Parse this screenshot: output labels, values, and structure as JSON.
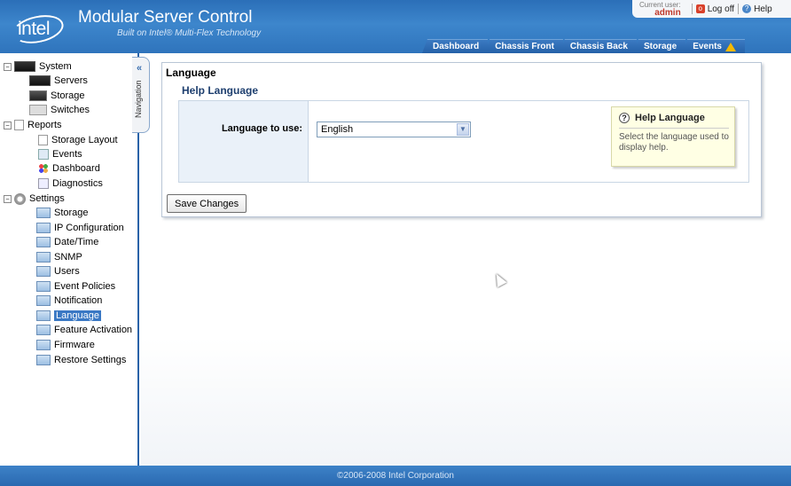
{
  "header": {
    "logo": "intel",
    "title": "Modular Server Control",
    "subtitle": "Built on Intel® Multi-Flex Technology",
    "current_user_label": "Current user:",
    "current_user": "admin",
    "logoff": "Log off",
    "help": "Help",
    "tabs": [
      "Dashboard",
      "Chassis Front",
      "Chassis Back",
      "Storage",
      "Events"
    ]
  },
  "nav_tab": {
    "chevron": "«",
    "label": "Navigation"
  },
  "sidebar": {
    "system": "System",
    "servers": "Servers",
    "storage": "Storage",
    "switches": "Switches",
    "reports": "Reports",
    "storage_layout": "Storage Layout",
    "events": "Events",
    "dashboard": "Dashboard",
    "diagnostics": "Diagnostics",
    "settings": "Settings",
    "settings_items": [
      "Storage",
      "IP Configuration",
      "Date/Time",
      "SNMP",
      "Users",
      "Event Policies",
      "Notification",
      "Language",
      "Feature Activation",
      "Firmware",
      "Restore Settings"
    ],
    "selected": "Language"
  },
  "main": {
    "title": "Language",
    "subtitle": "Help Language",
    "field_label": "Language to use:",
    "select_value": "English",
    "help_title": "Help Language",
    "help_text": "Select the language used to display help.",
    "save_button": "Save Changes"
  },
  "footer": {
    "copyright": "©2006-2008 Intel Corporation"
  },
  "colors": {
    "header_blue": "#2f74bc",
    "selected_blue": "#3a78c4",
    "warning": "#f5b800",
    "logoff_red": "#d9412b"
  }
}
